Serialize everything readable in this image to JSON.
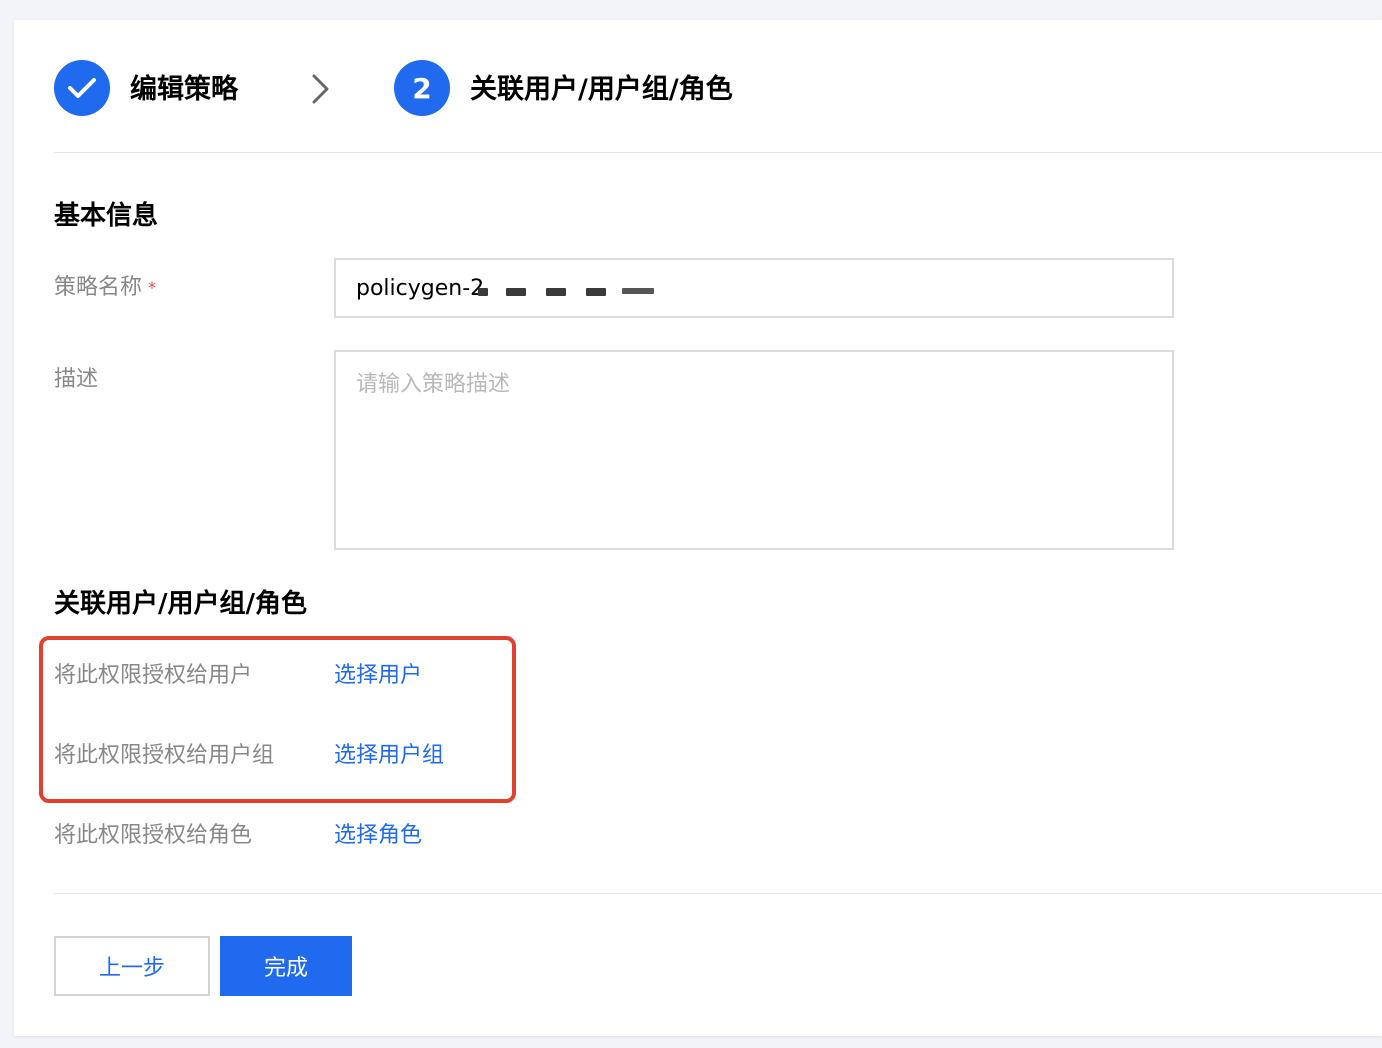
{
  "colors": {
    "primary": "#1f6aef",
    "highlight_border": "#e2402f",
    "required": "#e54545",
    "label_gray": "#888888",
    "page_bg": "#f3f4f7"
  },
  "steps": [
    {
      "icon": "check-icon",
      "label": "编辑策略",
      "state": "completed"
    },
    {
      "number": "2",
      "label": "关联用户/用户组/角色",
      "state": "active"
    }
  ],
  "basic_info": {
    "title": "基本信息",
    "policy_name": {
      "label": "策略名称",
      "required_mark": "*",
      "value": "policygen-2"
    },
    "description": {
      "label": "描述",
      "placeholder": "请输入策略描述"
    }
  },
  "association": {
    "title": "关联用户/用户组/角色",
    "rows": [
      {
        "label": "将此权限授权给用户",
        "action": "选择用户"
      },
      {
        "label": "将此权限授权给用户组",
        "action": "选择用户组"
      },
      {
        "label": "将此权限授权给角色",
        "action": "选择角色"
      }
    ]
  },
  "footer": {
    "prev_label": "上一步",
    "finish_label": "完成"
  }
}
